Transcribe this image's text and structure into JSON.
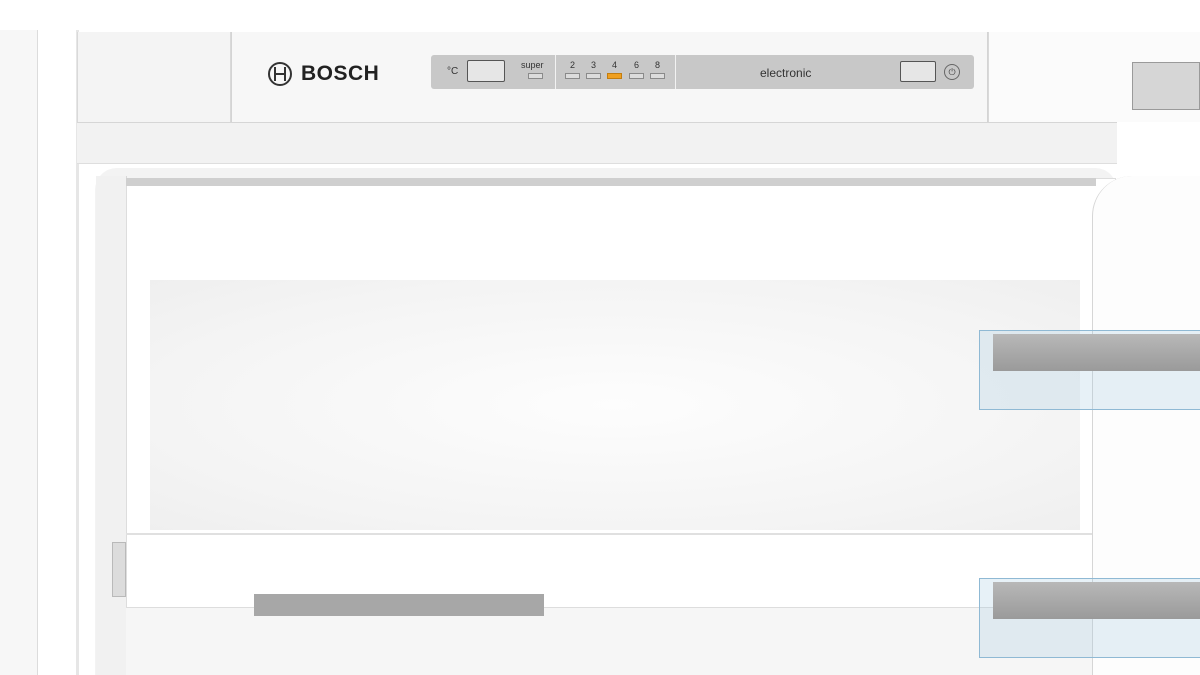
{
  "brand": "BOSCH",
  "controls": {
    "unit_label": "°C",
    "super_label": "super",
    "levels": [
      "2",
      "3",
      "4",
      "6",
      "8"
    ],
    "active_level": "4",
    "mode_label": "electronic"
  },
  "colors": {
    "active_led": "#f0a020",
    "panel_strip": "#c8c8c8",
    "handle": "#a7a7a7"
  },
  "icons": [
    "bosch-logo-icon",
    "power-button-icon"
  ]
}
